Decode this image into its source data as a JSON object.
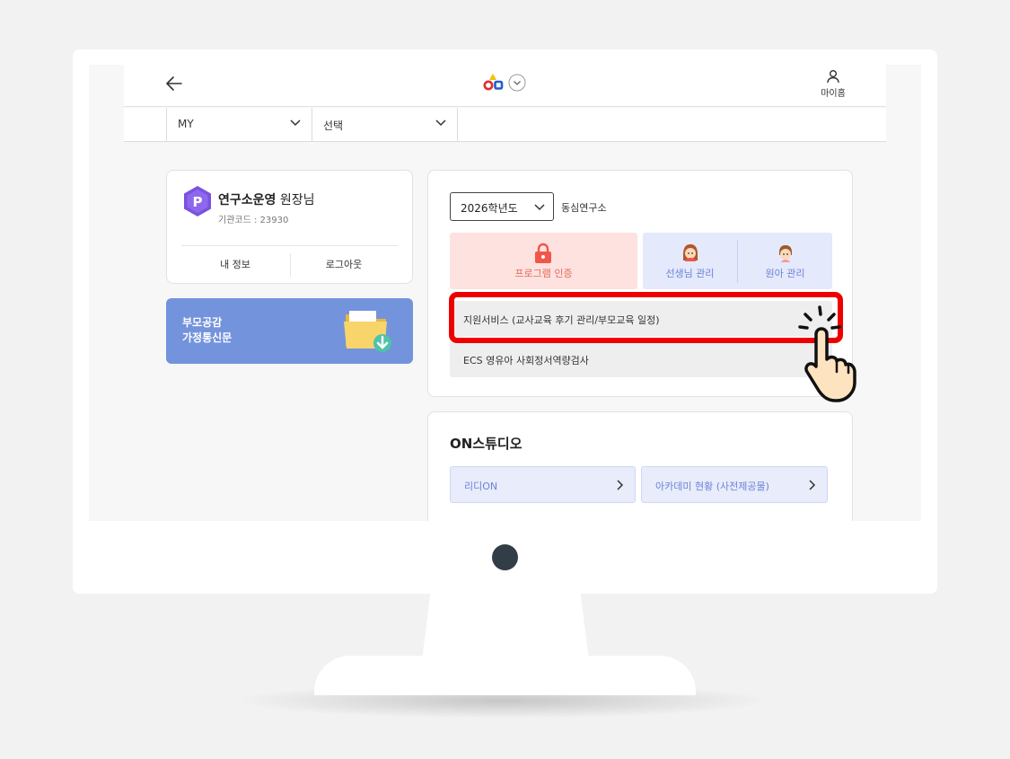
{
  "header": {
    "mypage_label": "마이홈"
  },
  "filters": {
    "first_select": "MY",
    "second_select": "선택"
  },
  "profile": {
    "name": "연구소운영",
    "title": "원장님",
    "institution_code": "기관코드 : 23930",
    "my_info_button": "내 정보",
    "logout_button": "로그아웃"
  },
  "banner": {
    "line1": "부모공감",
    "line2": "가정통신문"
  },
  "program": {
    "year_select": "2026학년도",
    "organization": "동심연구소",
    "tiles": {
      "program_auth": "프로그램 인증",
      "teacher_manage": "선생님 관리",
      "child_manage": "원아 관리"
    },
    "services": [
      "지원서비스 (교사교육 후기 관리/부모교육 일정)",
      "ECS 영유아 사회정서역량검사"
    ]
  },
  "studio": {
    "title": "ON스튜디오",
    "buttons": [
      "리디ON",
      "아카데미 현황 (사전제공물)"
    ]
  },
  "colors": {
    "highlight": "#ef0000",
    "banner": "#7393dc",
    "pink_tile": "#fde2df",
    "blue_tile": "#e4e9fb"
  }
}
